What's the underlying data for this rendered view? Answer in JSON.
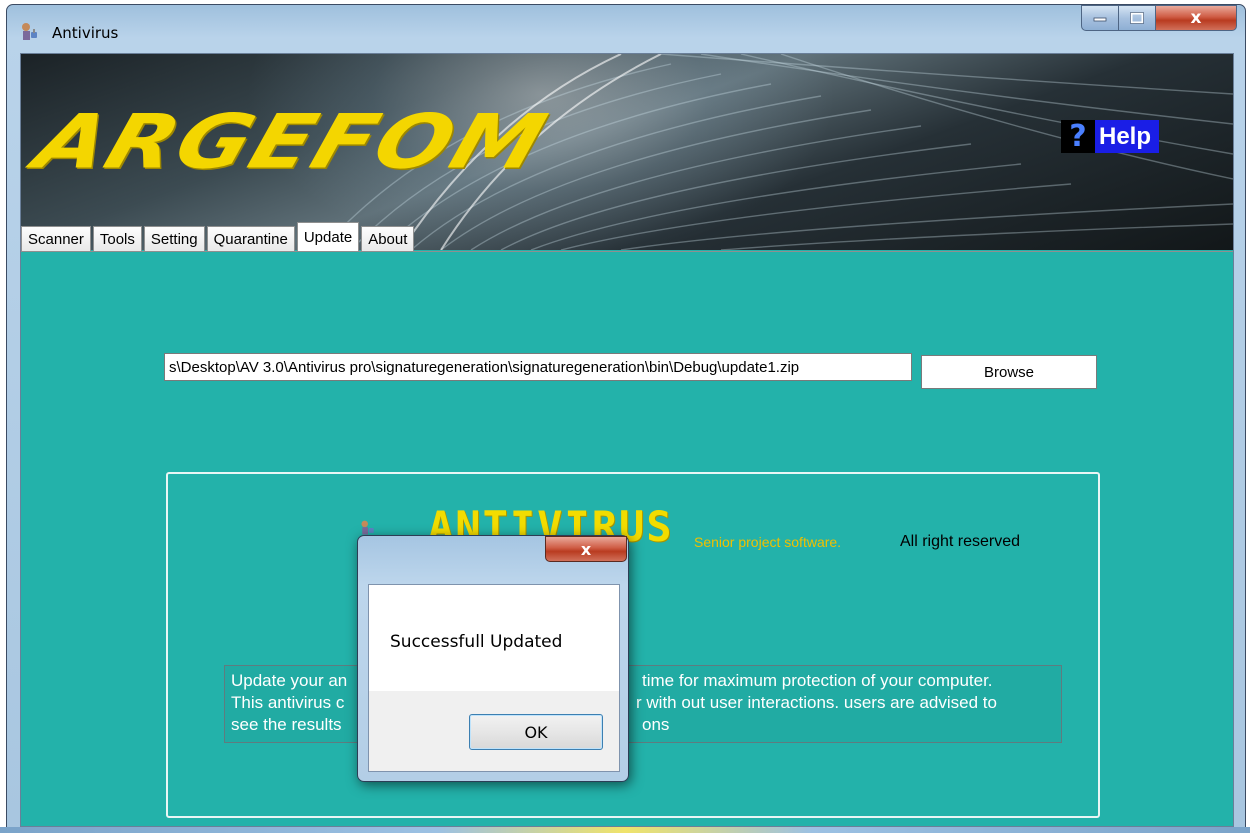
{
  "window": {
    "title": "Antivirus",
    "icon": "antivirus-app-icon",
    "controls": {
      "minimize": "minimize-icon",
      "maximize": "maximize-icon",
      "close": "x"
    }
  },
  "banner": {
    "logo_text": "ARGEFOM",
    "help_icon": "?",
    "help_label": "Help"
  },
  "tabs": [
    {
      "label": "Scanner",
      "active": false
    },
    {
      "label": "Tools",
      "active": false
    },
    {
      "label": "Setting",
      "active": false
    },
    {
      "label": "Quarantine",
      "active": false
    },
    {
      "label": "Update",
      "active": true
    },
    {
      "label": "About",
      "active": false
    }
  ],
  "update": {
    "path_value": "s\\Desktop\\AV 3.0\\Antivirus pro\\signaturegeneration\\signaturegeneration\\bin\\Debug\\update1.zip",
    "browse_label": "Browse"
  },
  "info": {
    "logo_text": "ANTIVIRUS",
    "tagline": "Senior project software.",
    "rights": "All right reserved",
    "description_lines": [
      "Update your an",
      "This antivirus c",
      "see the results",
      "time for maximum protection of your computer.",
      "r with out user interactions. users are advised to",
      "ons"
    ]
  },
  "dialog": {
    "close_label": "x",
    "message": "Successfull Updated",
    "ok_label": "OK"
  },
  "colors": {
    "content_bg": "#23b2aa",
    "logo_yellow": "#f4d600",
    "help_blue": "#1a1ee6"
  }
}
